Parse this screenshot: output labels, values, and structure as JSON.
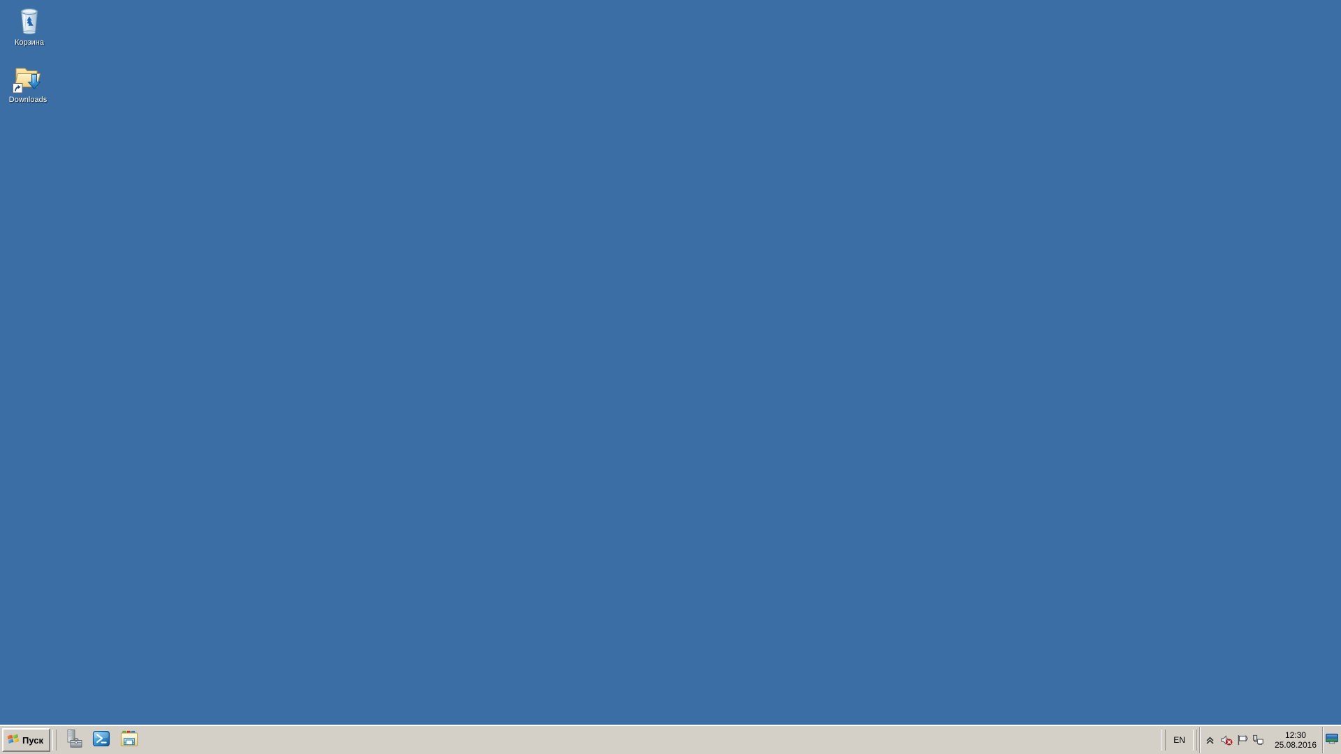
{
  "desktop": {
    "background_color": "#3a6ea5",
    "icons": [
      {
        "id": "recycle-bin",
        "label": "Корзина",
        "icon": "recycle-bin-icon"
      },
      {
        "id": "downloads",
        "label": "Downloads",
        "icon": "downloads-folder-shortcut-icon"
      }
    ]
  },
  "taskbar": {
    "background_color": "#d4d0c8",
    "start": {
      "label": "Пуск",
      "icon": "windows-logo-icon"
    },
    "quick_launch": [
      {
        "id": "server-manager",
        "title": "Server Manager",
        "icon": "server-manager-icon"
      },
      {
        "id": "powershell",
        "title": "Windows PowerShell",
        "icon": "powershell-icon"
      },
      {
        "id": "explorer",
        "title": "Windows Explorer",
        "icon": "windows-explorer-icon"
      }
    ],
    "language_bar": {
      "value": "EN"
    },
    "tray": {
      "icons": [
        {
          "id": "show-hidden",
          "title": "Show hidden icons",
          "icon": "chevron-up-icon"
        },
        {
          "id": "volume",
          "title": "Volume muted",
          "icon": "speaker-muted-icon"
        },
        {
          "id": "action-center",
          "title": "Action Center",
          "icon": "flag-icon"
        },
        {
          "id": "network",
          "title": "Network",
          "icon": "network-monitor-icon"
        }
      ]
    },
    "clock": {
      "time": "12:30",
      "date": "25.08.2016"
    },
    "show_desktop": {
      "title": "Show desktop",
      "icon": "show-desktop-icon"
    }
  }
}
